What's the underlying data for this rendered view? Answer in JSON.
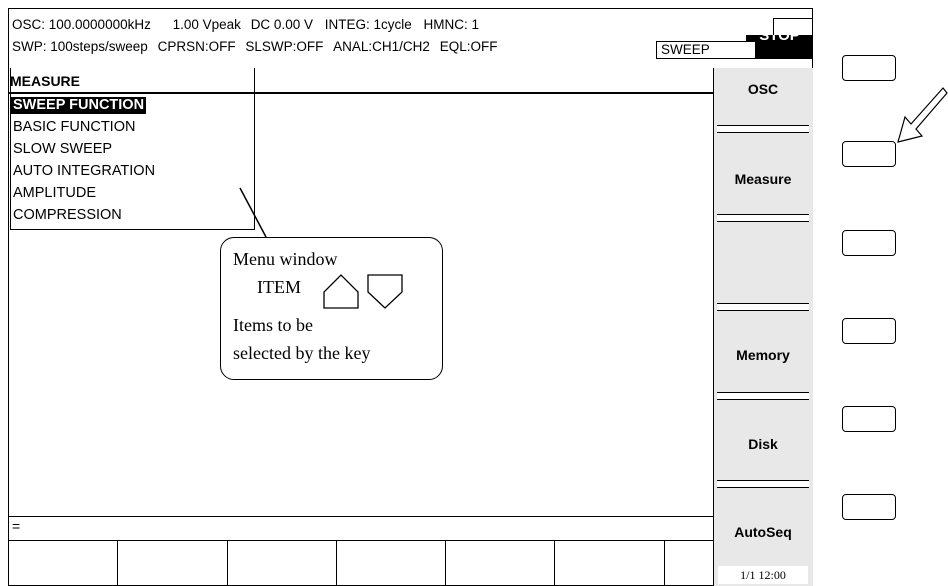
{
  "status": {
    "osc_freq": "OSC: 100.0000000kHz",
    "osc_amp": "1.00 Vpeak",
    "dc": "DC 0.00 V",
    "integ": "INTEG: 1cycle",
    "hmnc": "HMNC: 1",
    "swp": "SWP: 100steps/sweep",
    "cprsn": "CPRSN:OFF",
    "slswp": "SLSWP:OFF",
    "anal": "ANAL:CH1/CH2",
    "eql": "EQL:OFF",
    "mode_box": "SWEEP",
    "stop_indicator": "STOP"
  },
  "menu": {
    "title": "MEASURE",
    "items": [
      "SWEEP FUNCTION",
      "BASIC FUNCTION",
      "SLOW SWEEP",
      "AUTO INTEGRATION",
      "AMPLITUDE",
      "COMPRESSION"
    ],
    "selected_index": 0
  },
  "callout": {
    "line1": "Menu window",
    "line2": "ITEM",
    "line3": "Items to be",
    "line4": "selected by the key"
  },
  "input": {
    "text": "="
  },
  "softkeys": [
    "OSC",
    "Measure",
    "",
    "Memory",
    "Disk",
    "AutoSeq"
  ],
  "page_indicator": "1/1 12:00",
  "icons": [
    "up-arrow-icon",
    "down-arrow-icon",
    "pointer-arrow-icon"
  ]
}
